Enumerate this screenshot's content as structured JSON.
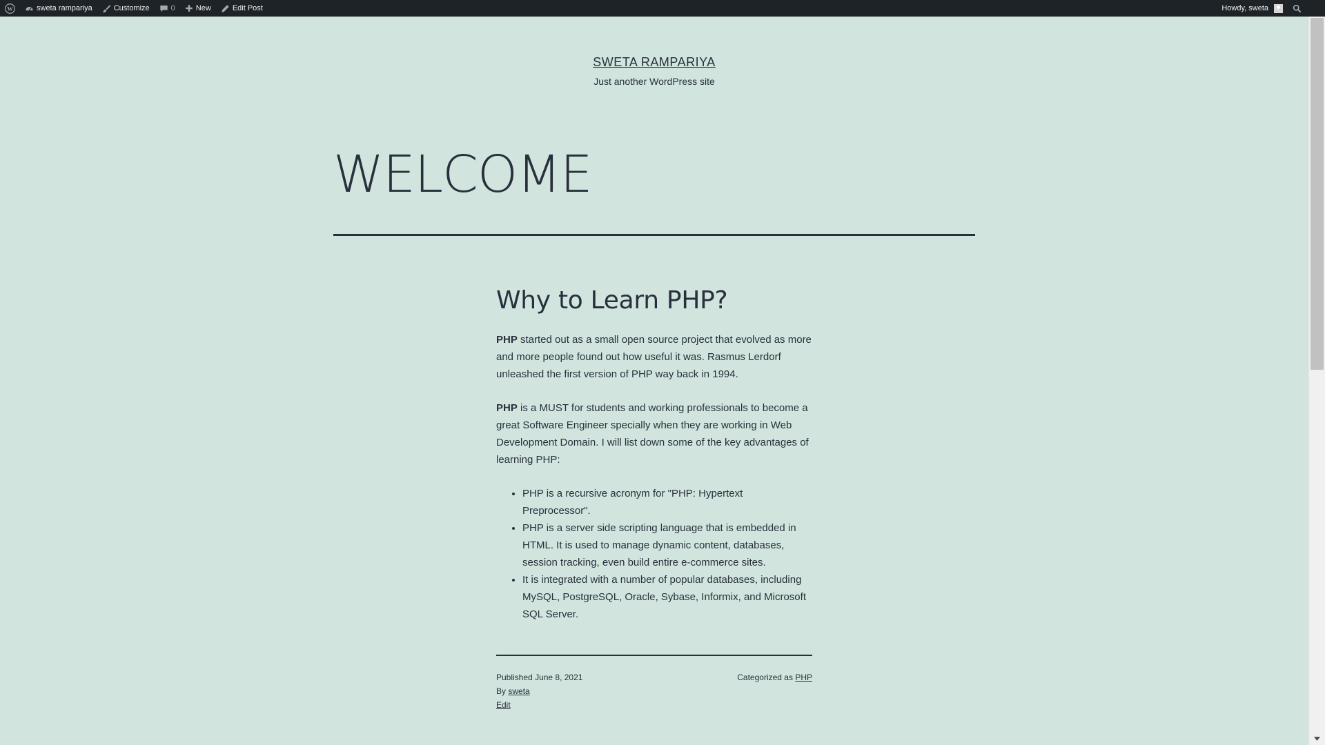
{
  "admin_bar": {
    "wp_logo_icon": "wordpress-logo-icon",
    "site_name": "sweta rampariya",
    "customize": "Customize",
    "comments_count": "0",
    "new": "New",
    "edit_post": "Edit Post",
    "howdy": "Howdy, sweta"
  },
  "site": {
    "title": "SWETA RAMPARIYA",
    "description": "Just another WordPress site"
  },
  "page": {
    "title": "WELCOME"
  },
  "post": {
    "heading": "Why to Learn PHP?",
    "p1_bold": "PHP",
    "p1_text": " started out as a small open source project that evolved as more and more people found out how useful it was. Rasmus Lerdorf unleashed the first version of PHP way back in 1994.",
    "p2_bold": "PHP",
    "p2_text": " is a MUST for students and working professionals to become a great Software Engineer specially when they are working in Web Development Domain. I will list down some of the key advantages of learning PHP:",
    "list": [
      "PHP is a recursive acronym for \"PHP: Hypertext Preprocessor\".",
      "PHP is a server side scripting language that is embedded in HTML. It is used to manage dynamic content, databases, session tracking, even build entire e-commerce sites.",
      "It is integrated with a number of popular databases, including MySQL, PostgreSQL, Oracle, Sybase, Informix, and Microsoft SQL Server."
    ]
  },
  "meta": {
    "published_label": "Published",
    "published_date": "June 8, 2021",
    "by_label": "By",
    "author": "sweta",
    "edit": "Edit",
    "categorized_label": "Categorized as",
    "category": "PHP"
  },
  "colors": {
    "background": "#d1e4dd",
    "text": "#28303d",
    "admin_bar": "#1d2327"
  }
}
